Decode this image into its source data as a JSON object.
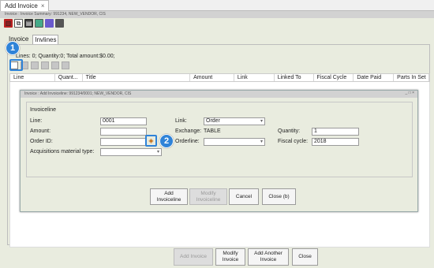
{
  "tab": {
    "title": "Add Invoice",
    "close": "×"
  },
  "window_title": "Invoice : Invoice Summary: 991234, NEW_VENDOR, CIS",
  "subtabs": [
    "Invoice",
    "Invlines"
  ],
  "summary": "Lines: 0; Quantity:0; Total amount:$0.00;",
  "columns": [
    "Line",
    "Quant...",
    "Title",
    "Amount",
    "Link",
    "Linked To",
    "Fiscal Cycle",
    "Date Paid",
    "Parts In Set"
  ],
  "dialog": {
    "title": "Invoice : Add Invoiceline: 991234/0001; NEW_VENDOR, CIS",
    "controls": "_ □ ×",
    "group": "Invoiceline",
    "line_label": "Line:",
    "line_value": "0001",
    "amount_label": "Amount:",
    "amount_value": "",
    "orderid_label": "Order ID:",
    "orderid_value": "",
    "acq_label": "Acquisitions material type:",
    "acq_value": "",
    "link_label": "Link:",
    "link_value": "Order",
    "exchange_label": "Exchange:",
    "exchange_value": "TABLE",
    "orderline_label": "Orderline:",
    "orderline_value": "",
    "quantity_label": "Quantity:",
    "quantity_value": "1",
    "fiscal_label": "Fiscal cycle:",
    "fiscal_value": "2018",
    "btn_add": "Add Invoiceline",
    "btn_modify": "Modify Invoiceline",
    "btn_cancel": "Cancel",
    "btn_close": "Close (b)"
  },
  "footer": {
    "add": "Add Invoice",
    "modify": "Modify Invoice",
    "add_another": "Add Another Invoice",
    "close": "Close"
  },
  "badges": {
    "one": "1",
    "two": "2"
  },
  "icons": [
    "invoice-icon",
    "copy-icon",
    "stack-icon",
    "folder-icon",
    "export-icon",
    "trash-icon"
  ]
}
